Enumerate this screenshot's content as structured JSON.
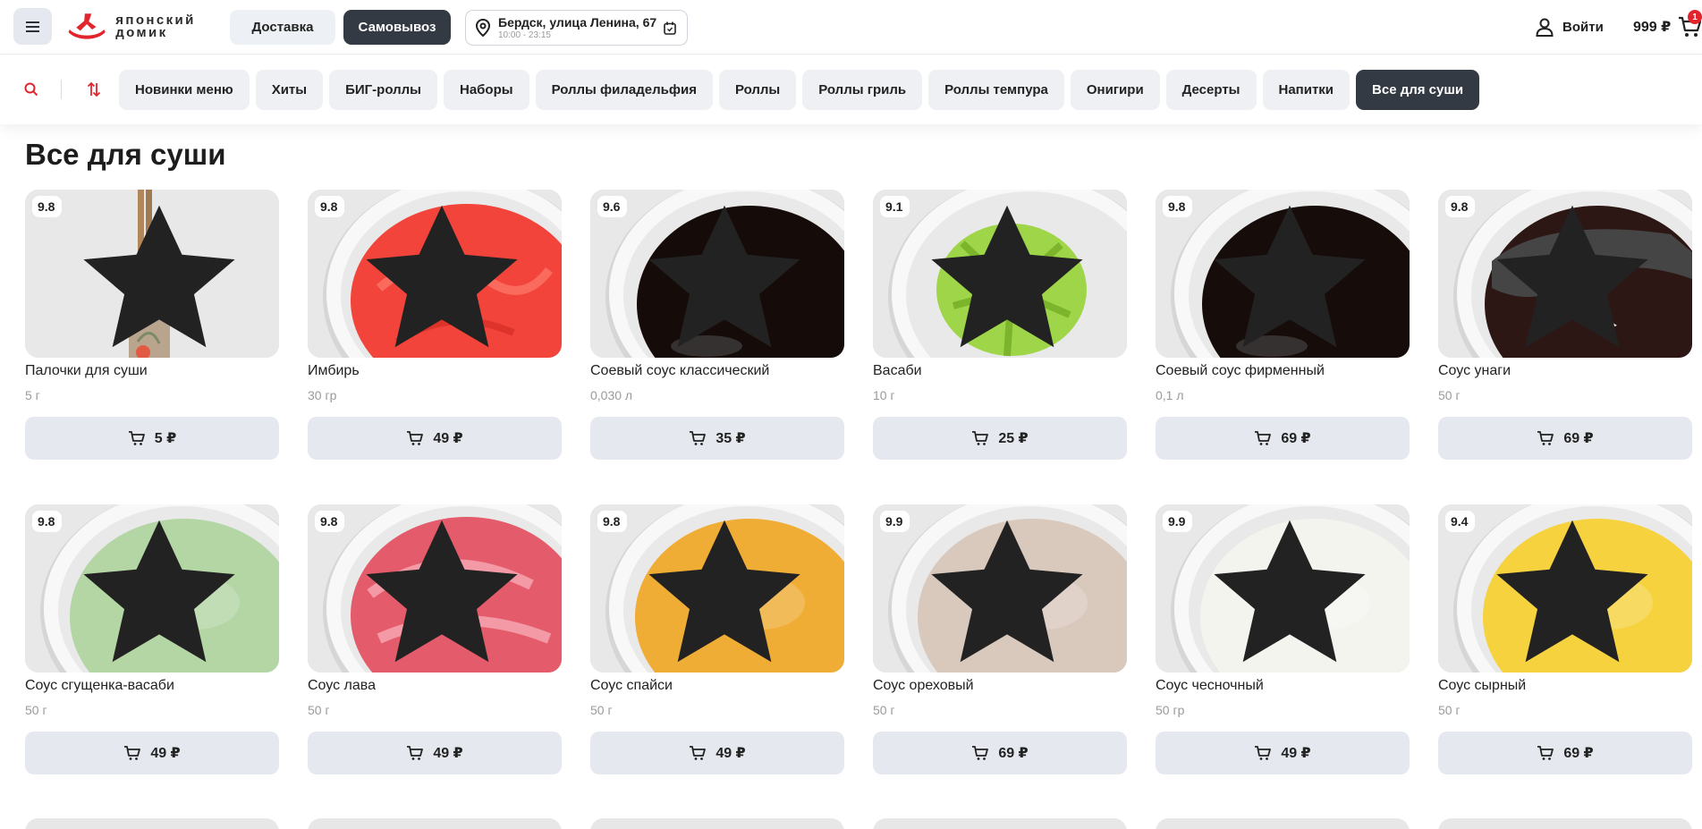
{
  "header": {
    "brand_logo_text": "японский домик",
    "delivery_label": "Доставка",
    "pickup_label": "Самовывоз",
    "address": "Бердск, улица Ленина, 67",
    "hours": "10:00 - 23:15",
    "login_label": "Войти",
    "cart_sum": "999 ₽",
    "cart_count": "1"
  },
  "categories": [
    {
      "label": "Новинки меню",
      "active": false
    },
    {
      "label": "Хиты",
      "active": false
    },
    {
      "label": "БИГ-роллы",
      "active": false
    },
    {
      "label": "Наборы",
      "active": false
    },
    {
      "label": "Роллы филадельфия",
      "active": false
    },
    {
      "label": "Роллы",
      "active": false
    },
    {
      "label": "Роллы гриль",
      "active": false
    },
    {
      "label": "Роллы темпура",
      "active": false
    },
    {
      "label": "Онигири",
      "active": false
    },
    {
      "label": "Десерты",
      "active": false
    },
    {
      "label": "Напитки",
      "active": false
    },
    {
      "label": "Все для суши",
      "active": true
    }
  ],
  "section": {
    "title": "Все для суши"
  },
  "products": [
    {
      "name": "Палочки для суши",
      "weight": "5 г",
      "price": "5 ₽",
      "rating": "9.8",
      "image": "chopsticks",
      "color": "#b69570"
    },
    {
      "name": "Имбирь",
      "weight": "30 гр",
      "price": "49 ₽",
      "rating": "9.8",
      "image": "ginger",
      "color": "#f2443a"
    },
    {
      "name": "Соевый соус классический",
      "weight": "0,030 л",
      "price": "35 ₽",
      "rating": "9.6",
      "image": "soy-sauce",
      "color": "#150b08"
    },
    {
      "name": "Васаби",
      "weight": "10 г",
      "price": "25 ₽",
      "rating": "9.1",
      "image": "wasabi",
      "color": "#9fd548"
    },
    {
      "name": "Соевый соус фирменный",
      "weight": "0,1 л",
      "price": "69 ₽",
      "rating": "9.8",
      "image": "soy-sauce",
      "color": "#160c09"
    },
    {
      "name": "Соус унаги",
      "weight": "50 г",
      "price": "69 ₽",
      "rating": "9.8",
      "image": "unagi-sauce",
      "color": "#2d1714"
    },
    {
      "name": "Соус сгущенка-васаби",
      "weight": "50 г",
      "price": "49 ₽",
      "rating": "9.8",
      "image": "sauce",
      "color": "#b4d6a5"
    },
    {
      "name": "Соус лава",
      "weight": "50 г",
      "price": "49 ₽",
      "rating": "9.8",
      "image": "lava-sauce",
      "color": "#e45b6b"
    },
    {
      "name": "Соус спайси",
      "weight": "50 г",
      "price": "49 ₽",
      "rating": "9.8",
      "image": "sauce",
      "color": "#f0ad35"
    },
    {
      "name": "Соус ореховый",
      "weight": "50 г",
      "price": "69 ₽",
      "rating": "9.9",
      "image": "sauce",
      "color": "#d9c9bd"
    },
    {
      "name": "Соус чесночный",
      "weight": "50 гр",
      "price": "49 ₽",
      "rating": "9.9",
      "image": "sauce",
      "color": "#f4f4ef"
    },
    {
      "name": "Соус сырный",
      "weight": "50 г",
      "price": "69 ₽",
      "rating": "9.4",
      "image": "sauce",
      "color": "#f6d23f"
    }
  ],
  "colors": {
    "brand_red": "#e1252d",
    "dark_button": "#343a43",
    "chip_bg": "#eef0f3",
    "buy_button_bg": "#e5e9ef"
  }
}
